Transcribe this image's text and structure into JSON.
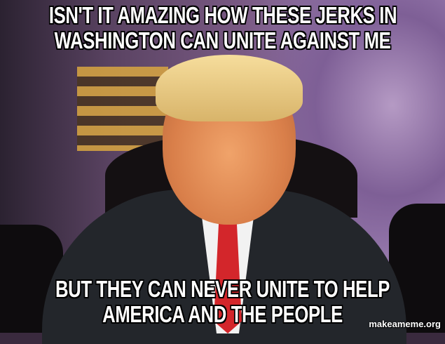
{
  "meme": {
    "top_text": [
      "ISN'T IT AMAZING HOW THESE JERKS IN",
      "WASHINGTON CAN UNITE AGAINST ME"
    ],
    "bottom_text": [
      "BUT THEY CAN NEVER UNITE TO HELP",
      "AMERICA AND THE PEOPLE"
    ],
    "watermark": "makeameme.org"
  }
}
